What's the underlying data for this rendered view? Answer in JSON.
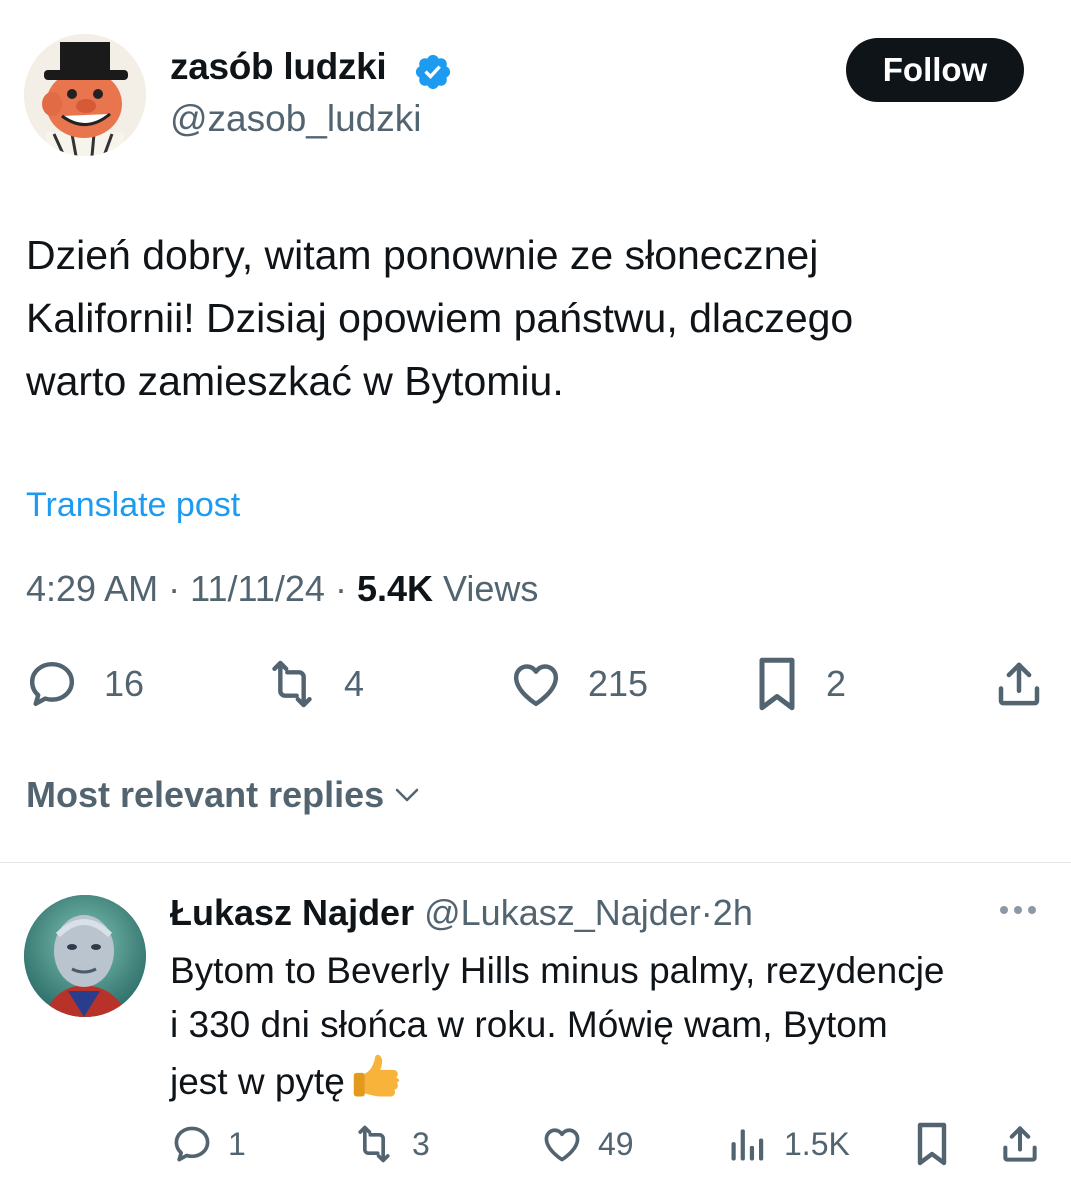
{
  "post": {
    "author_name": "zasób ludzki",
    "author_handle": "@zasob_ludzki",
    "follow_label": "Follow",
    "text_lines": [
      "Dzień dobry, witam ponownie ze słonecznej",
      "Kalifornii! Dzisiaj opowiem państwu, dlaczego",
      "warto zamieszkać w Bytomiu."
    ],
    "translate_label": "Translate post",
    "time": "4:29 AM",
    "date": "11/11/24",
    "separator": "·",
    "views_count": "5.4K",
    "views_label": "Views",
    "actions": {
      "replies": "16",
      "reposts": "4",
      "likes": "215",
      "bookmarks": "2"
    }
  },
  "replies_sort_label": "Most relevant replies",
  "reply": {
    "author_name": "Łukasz Najder",
    "author_handle": "@Lukasz_Najder",
    "separator": "·",
    "time": "2h",
    "text_lines": [
      "Bytom to Beverly Hills minus palmy, rezydencje",
      "i 330 dni słońca w roku. Mówię wam, Bytom",
      "jest w pytę"
    ],
    "actions": {
      "replies": "1",
      "reposts": "3",
      "likes": "49",
      "views": "1.5K"
    }
  },
  "colors": {
    "text": "#0f1419",
    "secondary": "#536471",
    "link": "#1d9bf0",
    "verified": "#1d9bf0",
    "button_bg": "#0f1419"
  },
  "icons": [
    "verified-badge-icon",
    "reply-icon",
    "repost-icon",
    "like-icon",
    "bookmark-icon",
    "share-icon",
    "chevron-down-icon",
    "more-icon",
    "views-icon",
    "thumbs-up-emoji"
  ]
}
